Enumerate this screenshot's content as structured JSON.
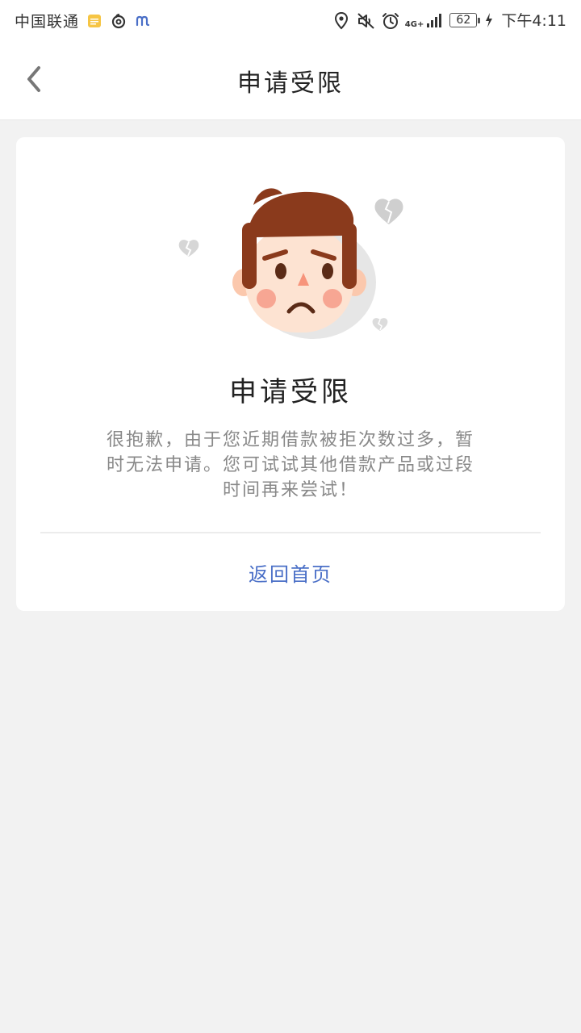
{
  "status_bar": {
    "carrier": "中国联通",
    "network": "4G+",
    "battery": "62",
    "time": "下午4:11"
  },
  "header": {
    "title": "申请受限"
  },
  "card": {
    "title": "申请受限",
    "message": "很抱歉，由于您近期借款被拒次数过多，暂时无法申请。您可试试其他借款产品或过段时间再来尝试！",
    "home_link": "返回首页"
  },
  "colors": {
    "page_background": "#f2f2f2",
    "card_background": "#ffffff",
    "link": "#4a6fc7",
    "message_text": "#888888",
    "hair": "#8a3a1c",
    "skin": "#fde3d2"
  },
  "icons": {
    "back": "chevron-left-icon",
    "location": "location-pin-icon",
    "mute": "speaker-muted-icon",
    "alarm": "alarm-clock-icon",
    "signal": "signal-bars-icon",
    "charging": "charging-bolt-icon",
    "illustration": "sad-face-illustration"
  }
}
